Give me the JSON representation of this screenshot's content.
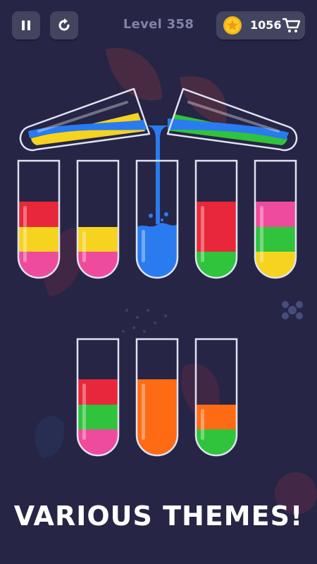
{
  "header": {
    "pause_icon": "pause-icon",
    "restart_icon": "restart-icon",
    "level_label": "Level 358",
    "coins": "1056",
    "coin_icon": "star-coin-icon",
    "shop_icon": "cart-icon"
  },
  "banner": {
    "text": "VARIOUS THEMES!"
  },
  "colors": {
    "red": "#e8283a",
    "yellow": "#f5d31f",
    "pink": "#ef4b9c",
    "blue": "#2a7bf0",
    "green": "#2fc43c",
    "orange": "#ff6b14"
  },
  "pouring": {
    "left_tube_layers_bottom_to_top": [
      "yellow",
      "blue"
    ],
    "right_tube_layers_bottom_to_top": [
      "green",
      "blue"
    ],
    "stream_color": "blue",
    "target": "tube-3"
  },
  "tubes": [
    {
      "id": "tube-1",
      "layers_bottom_to_top": [
        "pink",
        "yellow",
        "red"
      ]
    },
    {
      "id": "tube-2",
      "layers_bottom_to_top": [
        "pink",
        "yellow"
      ]
    },
    {
      "id": "tube-3",
      "layers_bottom_to_top": [
        "blue"
      ]
    },
    {
      "id": "tube-4",
      "layers_bottom_to_top": [
        "green",
        "red"
      ]
    },
    {
      "id": "tube-5",
      "layers_bottom_to_top": [
        "yellow",
        "green",
        "pink"
      ]
    },
    {
      "id": "tube-6",
      "layers_bottom_to_top": [
        "pink",
        "green",
        "red"
      ]
    },
    {
      "id": "tube-7",
      "layers_bottom_to_top": [
        "orange"
      ]
    },
    {
      "id": "tube-8",
      "layers_bottom_to_top": [
        "green",
        "orange"
      ]
    }
  ]
}
